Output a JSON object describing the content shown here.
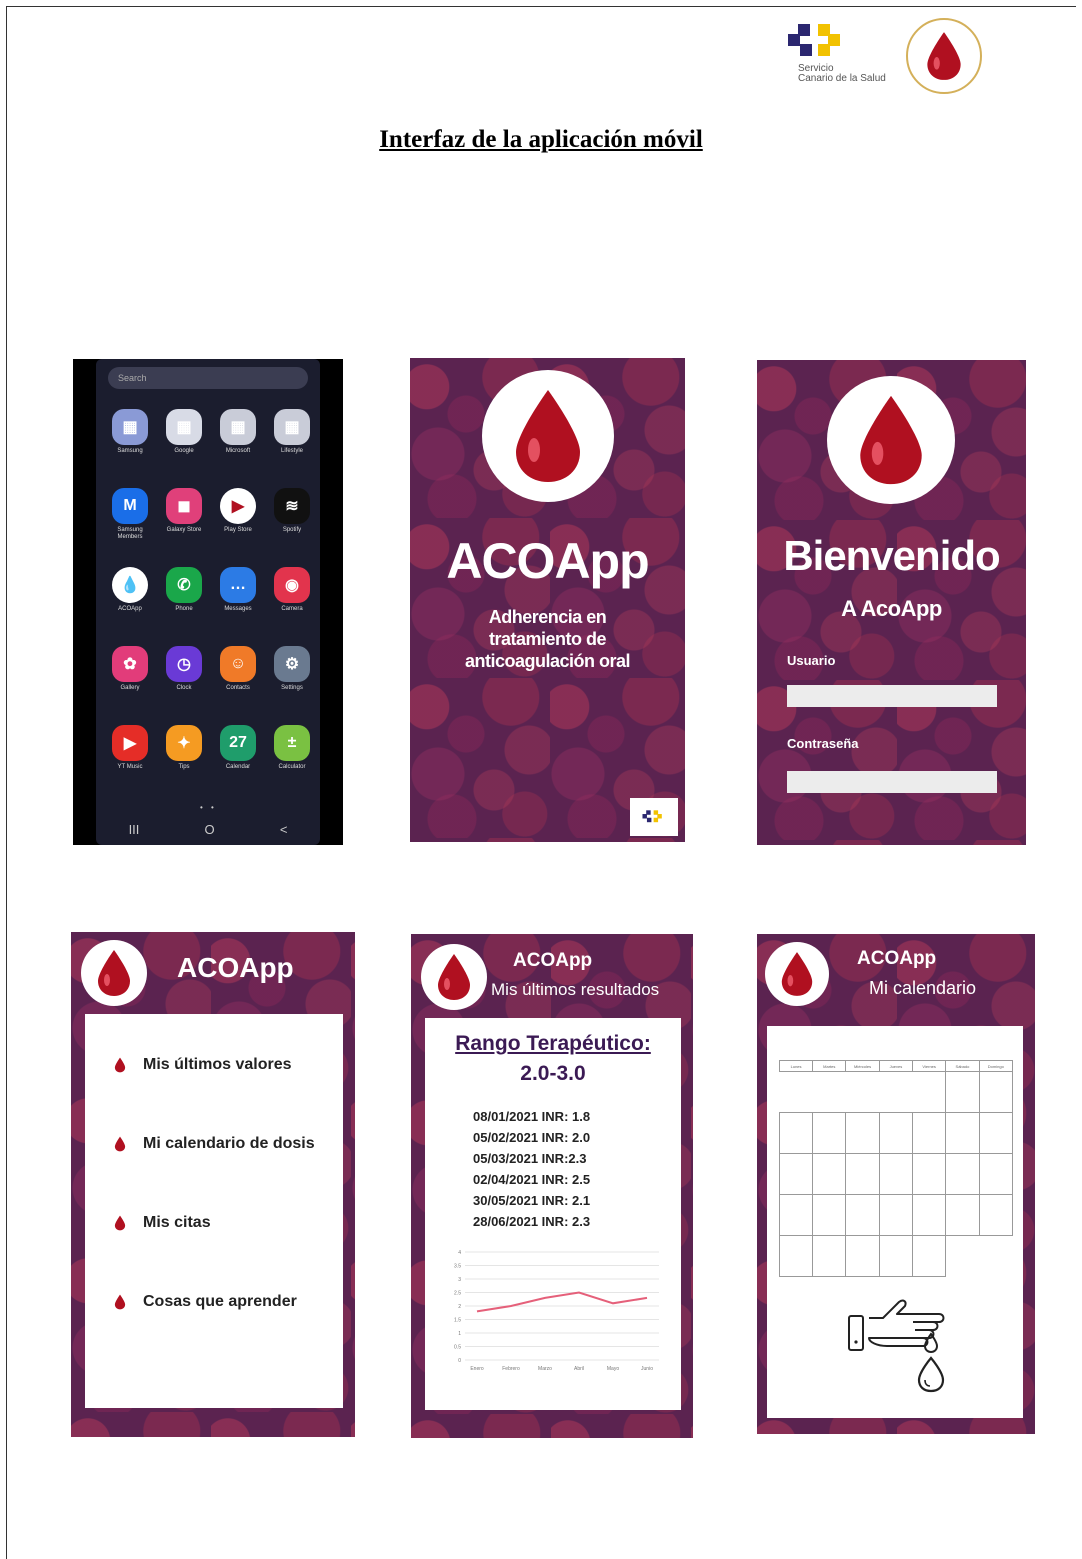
{
  "header": {
    "org_name_line1": "Servicio",
    "org_name_line2": "Canario de la Salud",
    "title": "Interfaz de la aplicación móvil"
  },
  "colors": {
    "purple_bg": "#5b2350",
    "blood_red": "#b01020",
    "dark_text": "#3b1a54"
  },
  "phone": {
    "search_placeholder": "Search",
    "apps": [
      {
        "label": "Samsung",
        "color": "#8a9ad6",
        "glyph": "▦"
      },
      {
        "label": "Google",
        "color": "#d8dbe6",
        "glyph": "▦"
      },
      {
        "label": "Microsoft",
        "color": "#c9ccd8",
        "glyph": "▦"
      },
      {
        "label": "Lifestyle",
        "color": "#c9ccd8",
        "glyph": "▦"
      },
      {
        "label": "Samsung Members",
        "color": "#1a6ee8",
        "glyph": "M"
      },
      {
        "label": "Galaxy Store",
        "color": "#e0407a",
        "glyph": "◼"
      },
      {
        "label": "Play Store",
        "color": "#ffffff",
        "glyph": "▶"
      },
      {
        "label": "Spotify",
        "color": "#111111",
        "glyph": "≋"
      },
      {
        "label": "ACOApp",
        "color": "#ffffff",
        "glyph": "💧"
      },
      {
        "label": "Phone",
        "color": "#1aa74a",
        "glyph": "✆"
      },
      {
        "label": "Messages",
        "color": "#2c7be5",
        "glyph": "…"
      },
      {
        "label": "Camera",
        "color": "#e2344d",
        "glyph": "◉"
      },
      {
        "label": "Gallery",
        "color": "#e23c7a",
        "glyph": "✿"
      },
      {
        "label": "Clock",
        "color": "#6a3ad6",
        "glyph": "◷"
      },
      {
        "label": "Contacts",
        "color": "#f07a28",
        "glyph": "☺"
      },
      {
        "label": "Settings",
        "color": "#6a7a90",
        "glyph": "⚙"
      },
      {
        "label": "YT Music",
        "color": "#e52d27",
        "glyph": "▶"
      },
      {
        "label": "Tips",
        "color": "#f59b22",
        "glyph": "✦"
      },
      {
        "label": "Calendar",
        "color": "#1f9d6b",
        "glyph": "27"
      },
      {
        "label": "Calculator",
        "color": "#7ac142",
        "glyph": "±"
      }
    ],
    "nav_recent": "III",
    "nav_home": "O",
    "nav_back": "<"
  },
  "splash": {
    "title": "ACOApp",
    "subtitle_line1": "Adherencia en",
    "subtitle_line2": "tratamiento de",
    "subtitle_line3": "anticoagulación oral"
  },
  "login": {
    "title": "Bienvenido",
    "subtitle": "A AcoApp",
    "user_label": "Usuario",
    "password_label": "Contraseña"
  },
  "menu": {
    "app_title": "ACOApp",
    "items": [
      "Mis últimos valores",
      "Mi calendario de dosis",
      "Mis citas",
      "Cosas que aprender"
    ]
  },
  "results": {
    "app_title": "ACOApp",
    "screen_title": "Mis últimos resultados",
    "range_label": "Rango Terapéutico:",
    "range_value": "2.0-3.0",
    "entries": [
      "08/01/2021 INR: 1.8",
      "05/02/2021 INR: 2.0",
      "05/03/2021 INR:2.3",
      "02/04/2021 INR: 2.5",
      "30/05/2021 INR: 2.1",
      "28/06/2021 INR: 2.3"
    ]
  },
  "calendar": {
    "app_title": "ACOApp",
    "screen_title": "Mi calendario",
    "weekdays": [
      "Lunes",
      "Martes",
      "Miércoles",
      "Jueves",
      "Viernes",
      "Sábado",
      "Domingo"
    ]
  },
  "chart_data": {
    "type": "line",
    "categories": [
      "Enero",
      "Febrero",
      "Marzo",
      "Abril",
      "Mayo",
      "Junio"
    ],
    "series": [
      {
        "values": [
          1.8,
          2.0,
          2.3,
          2.5,
          2.1,
          2.3
        ]
      }
    ],
    "ylim": [
      0,
      4
    ],
    "yticks": [
      "0",
      "0.5",
      "1",
      "1.5",
      "2",
      "2.5",
      "3",
      "3.5",
      "4"
    ],
    "grid": true
  }
}
